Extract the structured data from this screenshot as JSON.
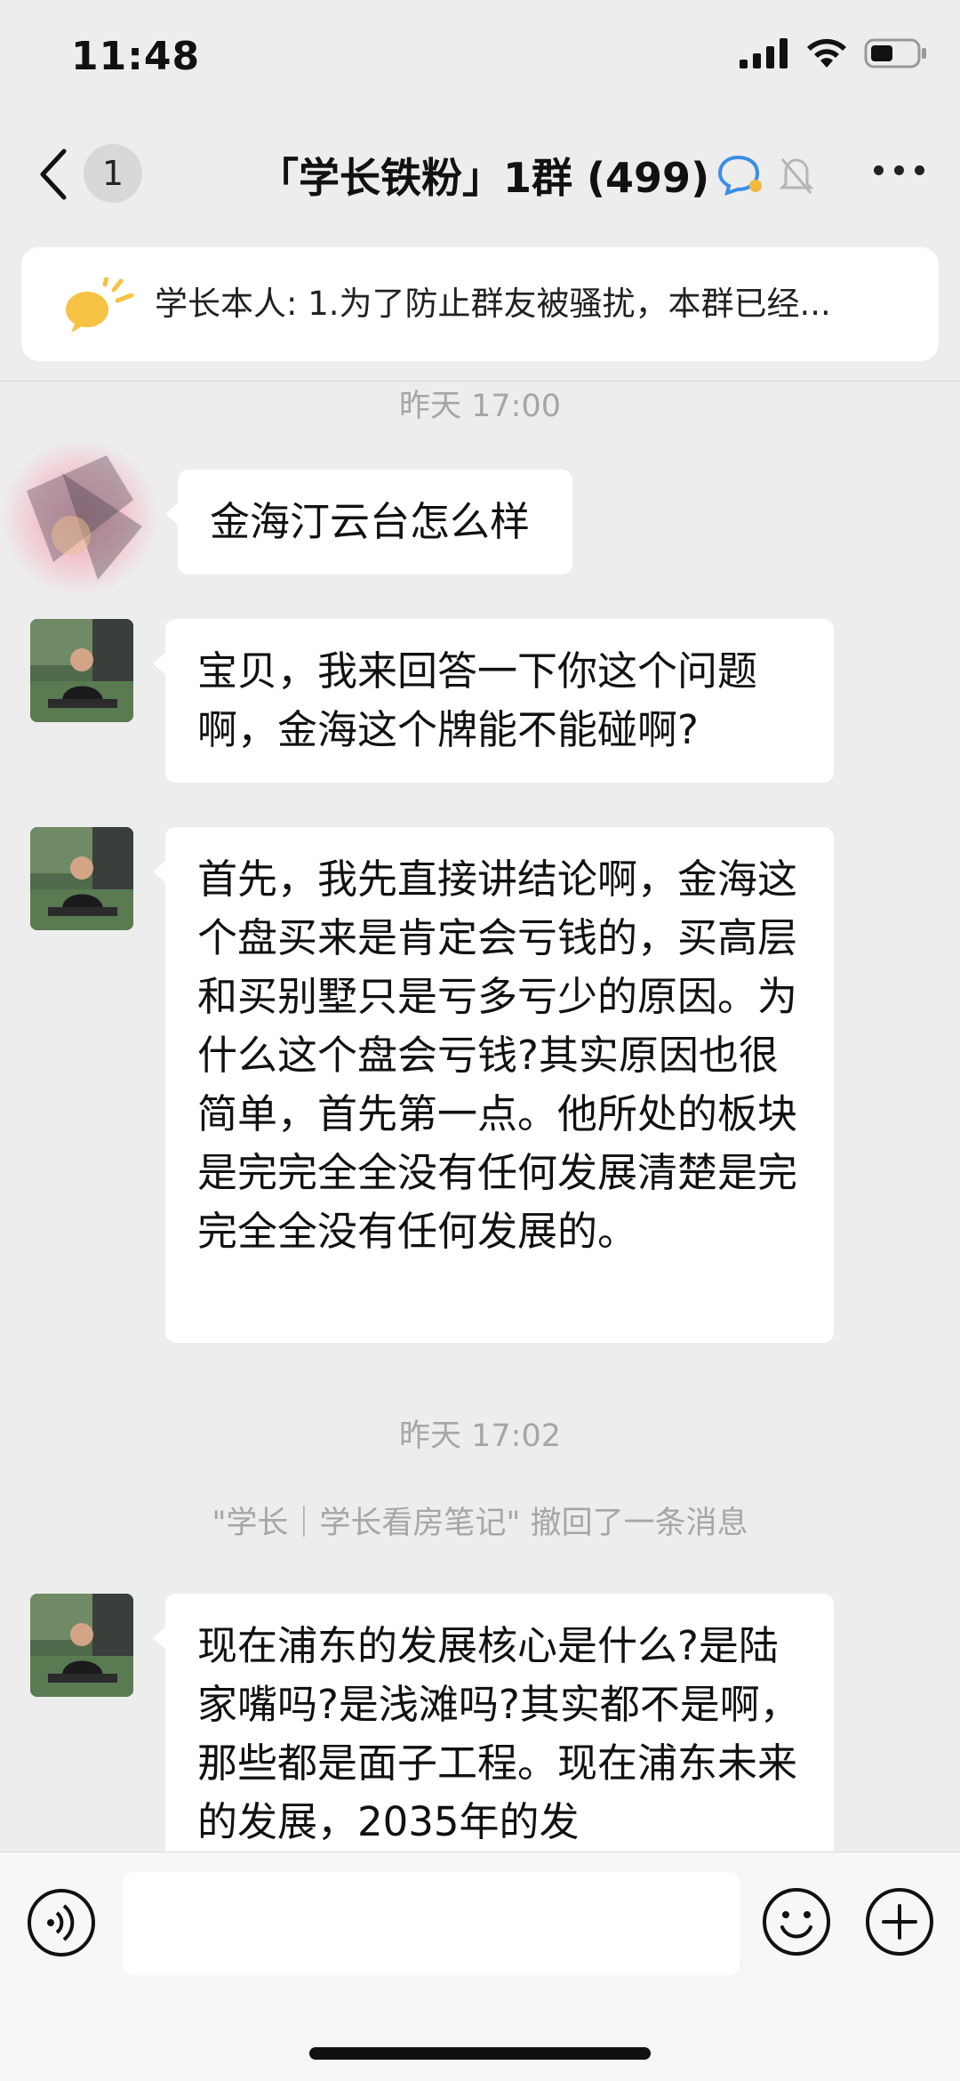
{
  "status_bar": {
    "time": "11:48"
  },
  "nav": {
    "unread_badge": "1",
    "title": "「学长铁粉」1群 (499)"
  },
  "notice": {
    "text": "学长本人: 1.为了防止群友被骚扰，本群已经..."
  },
  "timestamps": {
    "t1": "昨天 17:00",
    "t2": "昨天 17:02"
  },
  "system_message": "\"学长｜学长看房笔记\" 撤回了一条消息",
  "messages": [
    {
      "text": "金海汀云台怎么样"
    },
    {
      "text": "宝贝，我来回答一下你这个问题啊，金海这个牌能不能碰啊?"
    },
    {
      "text": "首先，我先直接讲结论啊，金海这个盘买来是肯定会亏钱的，买高层和买别墅只是亏多亏少的原因。为什么这个盘会亏钱?其实原因也很简单，首先第一点。他所处的板块是完完全全没有任何发展清楚是完完全全没有任何发展的。"
    },
    {
      "text": "现在浦东的发展核心是什么?是陆家嘴吗?是浅滩吗?其实都不是啊，那些都是面子工程。现在浦东未来的发展，2035年的发"
    }
  ],
  "input": {
    "placeholder": ""
  },
  "icons": [
    "signal-icon",
    "wifi-icon",
    "battery-icon",
    "back-chevron-icon",
    "chat-bubble-icon",
    "mute-bell-icon",
    "more-icon",
    "announcement-icon",
    "voice-icon",
    "emoji-icon",
    "plus-icon"
  ],
  "colors": {
    "background": "#ededed",
    "bubble": "#ffffff",
    "notice_icon": "#f6c244",
    "muted_text": "#a6a6a6"
  }
}
